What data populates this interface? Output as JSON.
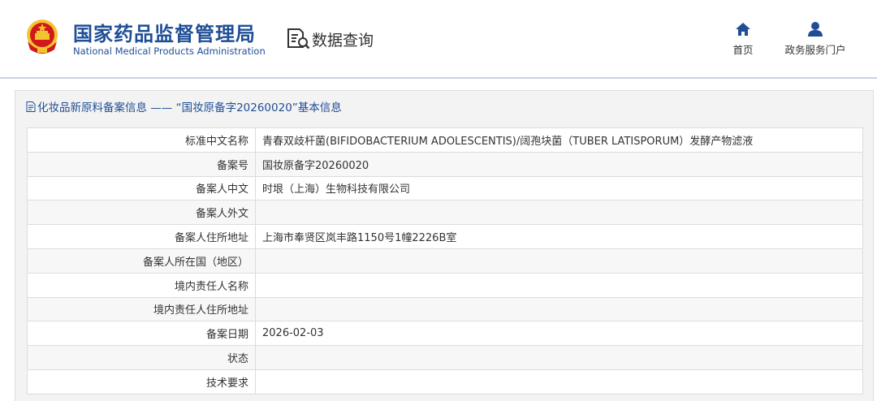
{
  "header": {
    "org_name_cn": "国家药品监督管理局",
    "org_name_en": "National Medical Products Administration",
    "query_title": "数据查询",
    "nav": [
      {
        "label": "首页",
        "icon": "home-icon"
      },
      {
        "label": "政务服务门户",
        "icon": "user-icon"
      }
    ]
  },
  "colors": {
    "brand": "#1f4e96",
    "emblem_red": "#d0191a",
    "emblem_gold": "#f2c530"
  },
  "panel": {
    "title": "化妆品新原料备案信息 —— “国妆原备字20260020”基本信息",
    "rows": [
      {
        "label": "标准中文名称",
        "value": "青春双歧杆菌(BIFIDOBACTERIUM ADOLESCENTIS)/阔孢块菌（TUBER LATISPORUM）发酵产物滤液"
      },
      {
        "label": "备案号",
        "value": "国妆原备字20260020"
      },
      {
        "label": "备案人中文",
        "value": "时垠（上海）生物科技有限公司"
      },
      {
        "label": "备案人外文",
        "value": ""
      },
      {
        "label": "备案人住所地址",
        "value": "上海市奉贤区岚丰路1150号1幢2226B室"
      },
      {
        "label": "备案人所在国（地区）",
        "value": ""
      },
      {
        "label": "境内责任人名称",
        "value": ""
      },
      {
        "label": "境内责任人住所地址",
        "value": ""
      },
      {
        "label": "备案日期",
        "value": "2026-02-03"
      },
      {
        "label": "状态",
        "value": ""
      },
      {
        "label": "技术要求",
        "value": ""
      }
    ]
  }
}
